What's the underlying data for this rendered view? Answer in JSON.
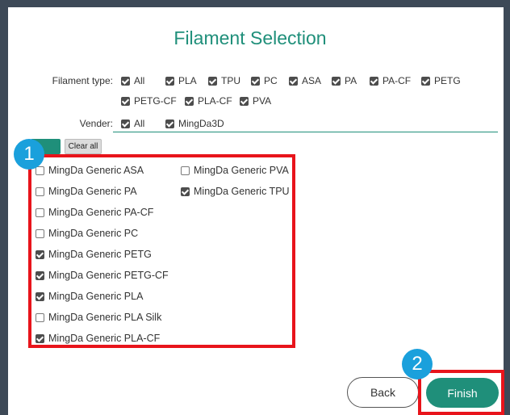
{
  "title": "Filament Selection",
  "filament_type": {
    "label": "Filament type:",
    "options": [
      {
        "label": "All",
        "checked": true
      },
      {
        "label": "PLA",
        "checked": true
      },
      {
        "label": "TPU",
        "checked": true
      },
      {
        "label": "PC",
        "checked": true
      },
      {
        "label": "ASA",
        "checked": true
      },
      {
        "label": "PA",
        "checked": true
      },
      {
        "label": "PA-CF",
        "checked": true
      },
      {
        "label": "PETG",
        "checked": true
      },
      {
        "label": "PETG-CF",
        "checked": true
      },
      {
        "label": "PLA-CF",
        "checked": true
      },
      {
        "label": "PVA",
        "checked": true
      }
    ]
  },
  "vender": {
    "label": "Vender:",
    "options": [
      {
        "label": "All",
        "checked": true
      },
      {
        "label": "MingDa3D",
        "checked": true
      }
    ]
  },
  "actions": {
    "clear_all": "Clear all"
  },
  "filaments": [
    {
      "label": "MingDa Generic ASA",
      "checked": false
    },
    {
      "label": "MingDa Generic PA",
      "checked": false
    },
    {
      "label": "MingDa Generic PA-CF",
      "checked": false
    },
    {
      "label": "MingDa Generic PC",
      "checked": false
    },
    {
      "label": "MingDa Generic PETG",
      "checked": true
    },
    {
      "label": "MingDa Generic PETG-CF",
      "checked": true
    },
    {
      "label": "MingDa Generic PLA",
      "checked": true
    },
    {
      "label": "MingDa Generic PLA Silk",
      "checked": false
    },
    {
      "label": "MingDa Generic PLA-CF",
      "checked": true
    },
    {
      "label": "MingDa Generic PVA",
      "checked": false
    },
    {
      "label": "MingDa Generic TPU",
      "checked": true
    }
  ],
  "annotations": {
    "badge_1": "1",
    "badge_2": "2"
  },
  "footer": {
    "back": "Back",
    "finish": "Finish"
  }
}
